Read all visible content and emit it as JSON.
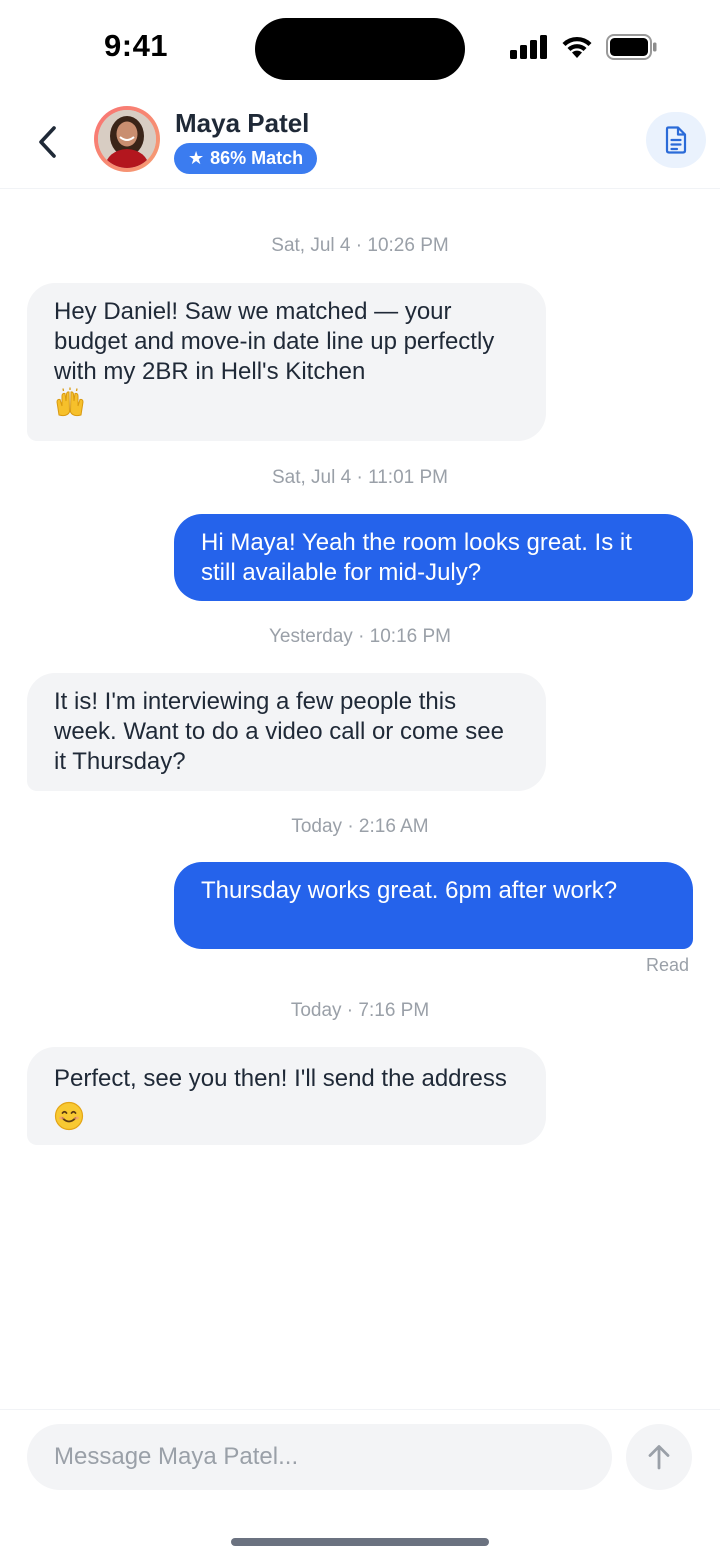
{
  "status_bar": {
    "time": "9:41",
    "icons": [
      "signal-icon",
      "wifi-icon",
      "battery-icon"
    ]
  },
  "header": {
    "contact_name": "Maya Patel",
    "match_badge": "86% Match",
    "match_star": "★",
    "icons": [
      "back-chevron-icon",
      "document-icon"
    ]
  },
  "messages": [
    {
      "timestamp": "Sat, Jul 4 · 10:26 PM",
      "direction": "in",
      "text": "Hey Daniel! Saw we matched — your budget and move-in date line up perfectly with my 2BR in Hell's Kitchen",
      "emoji": "raised-hands"
    },
    {
      "timestamp": "Sat, Jul 4 · 11:01 PM",
      "direction": "out",
      "text": "Hi Maya! Yeah the room looks great. Is it still available for mid-July?"
    },
    {
      "timestamp": "Yesterday · 10:16 PM",
      "direction": "in",
      "text": "It is! I'm interviewing a few people this week. Want to do a video call or come see it Thursday?"
    },
    {
      "timestamp": "Today · 2:16 AM",
      "direction": "out",
      "text": "Thursday works great. 6pm after work?",
      "receipt": "Read"
    },
    {
      "timestamp": "Today · 7:16 PM",
      "direction": "in",
      "text": "Perfect, see you then! I'll send the address",
      "emoji": "smiling-face"
    }
  ],
  "composer": {
    "placeholder": "Message Maya Patel...",
    "value": "",
    "send_icon": "arrow-up-icon"
  },
  "colors": {
    "accent": "#2563eb",
    "badge": "#3b7cf0",
    "incoming_bubble": "#f3f4f6",
    "timestamp": "#9aa0a8"
  }
}
